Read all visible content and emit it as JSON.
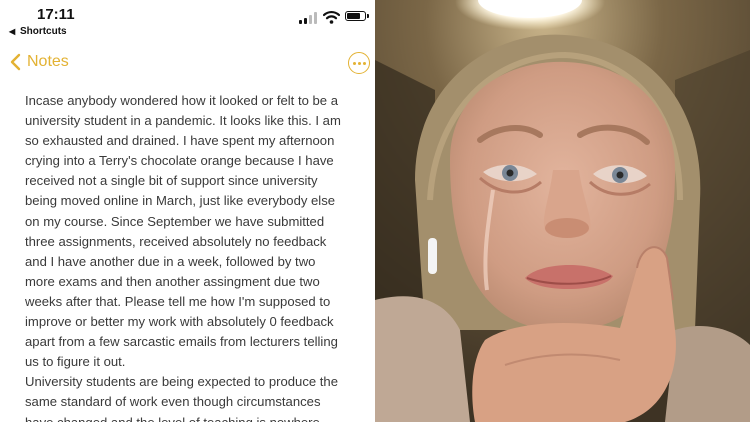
{
  "status_bar": {
    "time": "17:11",
    "back_app": "Shortcuts",
    "back_app_icon": "back-triangle-icon",
    "signal_bars": 2,
    "battery_level": 0.85,
    "icons": [
      "cellular-signal-icon",
      "wifi-icon",
      "battery-icon"
    ]
  },
  "nav": {
    "back_label": "Notes",
    "back_icon": "chevron-left-icon",
    "more_icon": "ellipsis-circle-icon",
    "accent_color": "#e3b233"
  },
  "note": {
    "lines": [
      "Incase anybody wondered how it looked or felt to be a",
      "university student in a pandemic. It looks like this. I am",
      "so exhausted and drained. I have spent my afternoon",
      "crying into a Terry's chocolate orange because I have",
      "received not a single bit of support since university",
      "being moved online in March, just like everybody else",
      "on my course. Since September we have submitted",
      "three assignments, received absolutely no feedback",
      "and I have another due in a week, followed by two",
      "more exams and then another assingment due two",
      "weeks after that. Please tell me how I'm supposed to",
      "improve or better my work with absolutely 0 feedback",
      "apart from a few sarcastic emails from lecturers telling",
      "us to figure it out.",
      "University students are being expected to produce the",
      "same standard of work even though circumstances",
      "have changed and the level of teaching is nowhere"
    ],
    "text_color": "#3a3a3a"
  },
  "photo": {
    "subject": "crying-student-photo",
    "background_color": "#5a4a34",
    "skin_color": "#d6a58c"
  }
}
